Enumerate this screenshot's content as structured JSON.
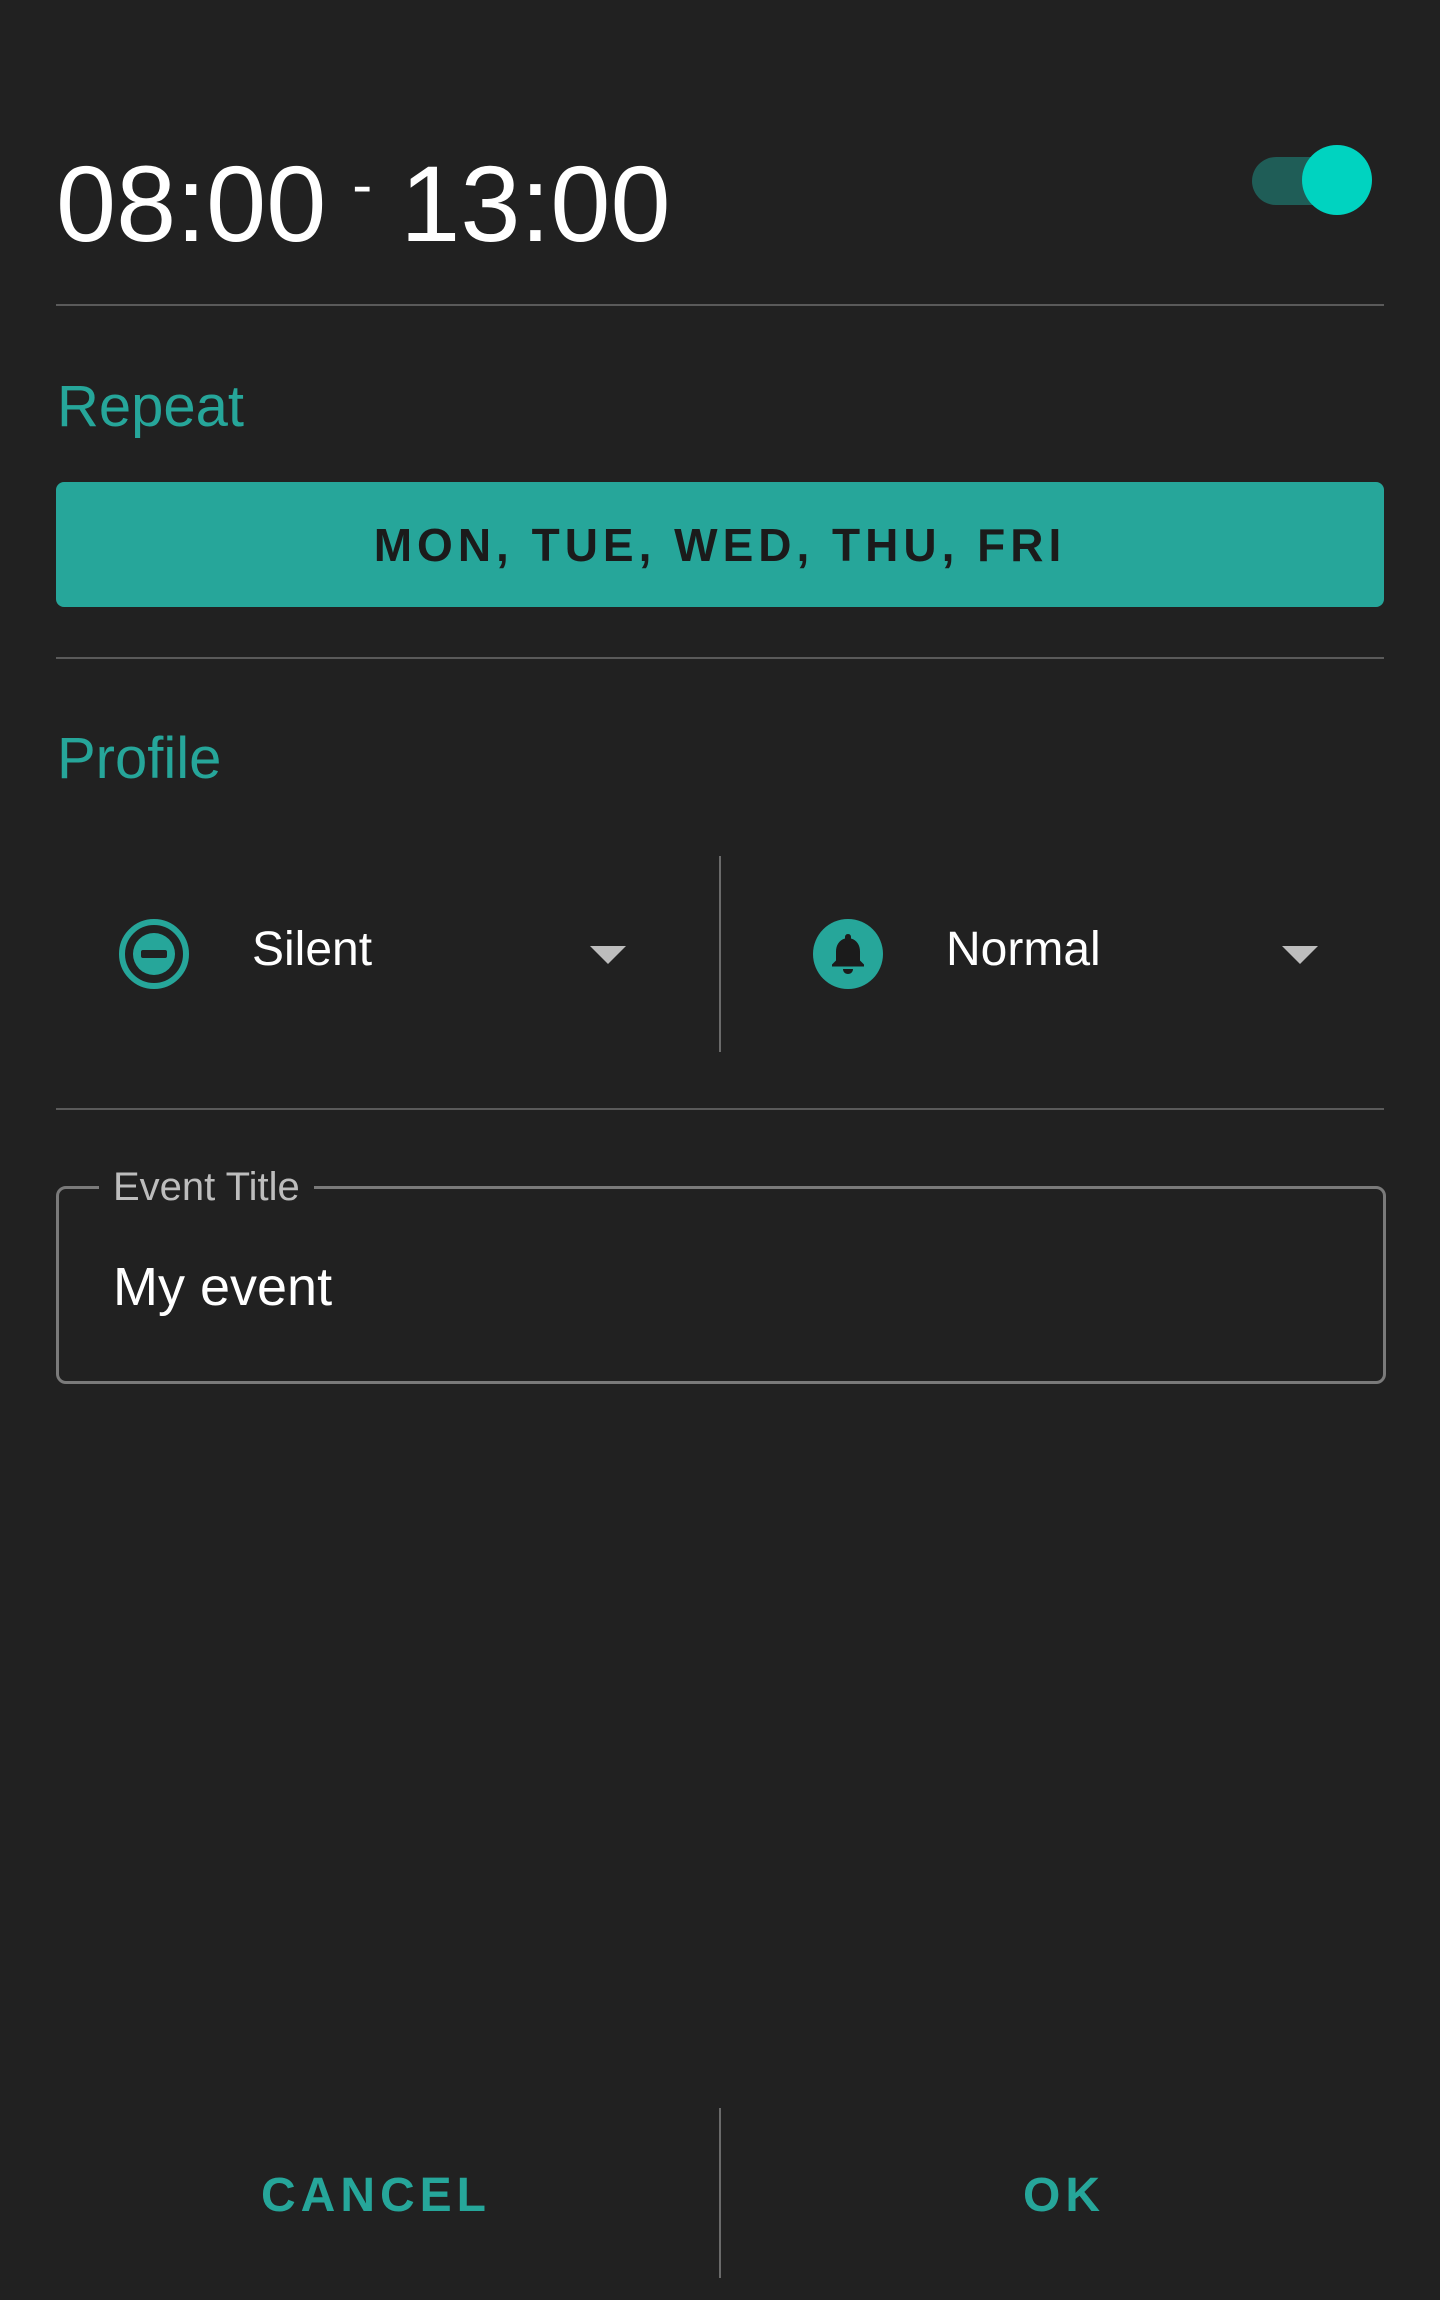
{
  "header": {
    "start_time": "08:00",
    "separator": "-",
    "end_time": "13:00",
    "enabled": true
  },
  "repeat": {
    "title": "Repeat",
    "days_label": "MON, TUE, WED, THU, FRI"
  },
  "profile": {
    "title": "Profile",
    "start_profile": {
      "label": "Silent",
      "icon": "do-not-disturb-icon"
    },
    "end_profile": {
      "label": "Normal",
      "icon": "bell-icon"
    }
  },
  "event_title": {
    "label": "Event Title",
    "value": "My event"
  },
  "actions": {
    "cancel_label": "CANCEL",
    "ok_label": "OK"
  },
  "colors": {
    "background": "#212121",
    "accent": "#26a69a",
    "switch_thumb": "#00d3c0",
    "switch_track": "#1f5d57",
    "divider": "#5a5a5a"
  }
}
